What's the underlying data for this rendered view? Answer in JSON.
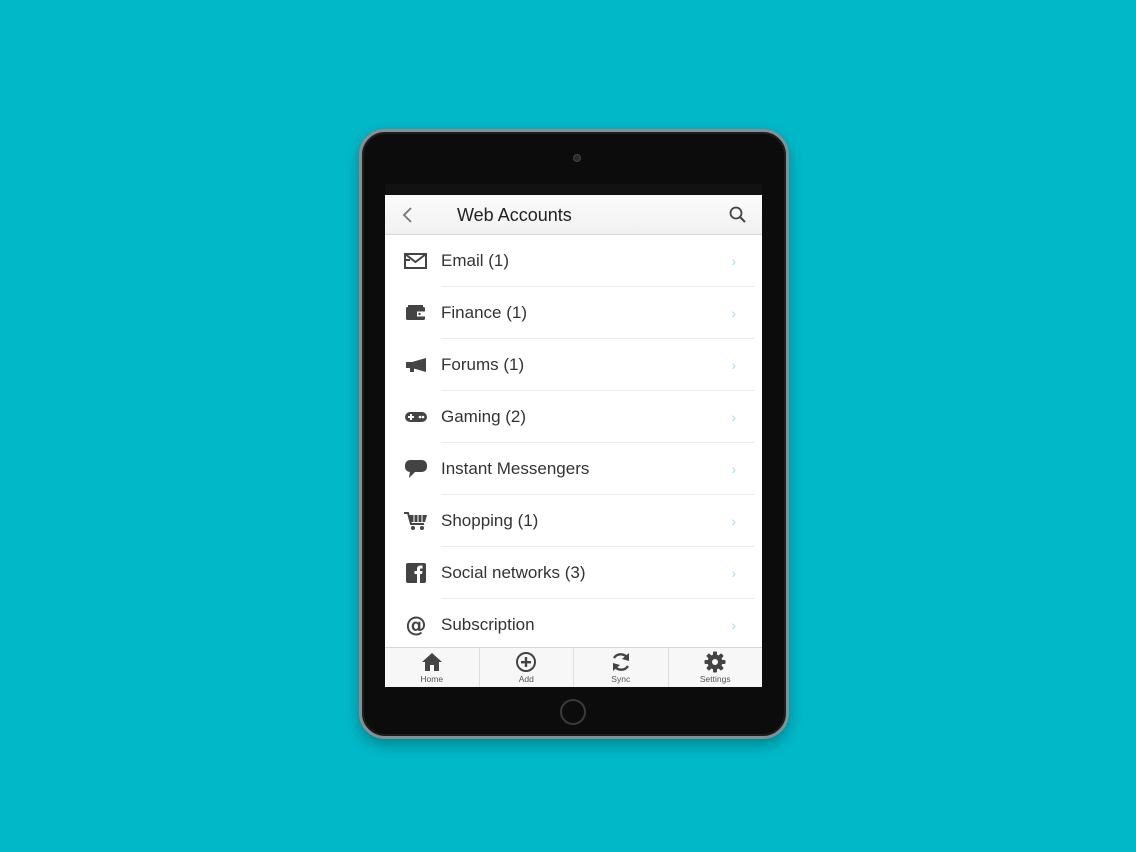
{
  "navbar": {
    "title": "Web Accounts",
    "back_icon": "chevron-left-icon",
    "search_icon": "search-icon"
  },
  "list": {
    "items": [
      {
        "label": "Email (1)",
        "icon": "envelope-icon"
      },
      {
        "label": "Finance (1)",
        "icon": "wallet-icon"
      },
      {
        "label": "Forums (1)",
        "icon": "megaphone-icon"
      },
      {
        "label": "Gaming (2)",
        "icon": "gamepad-icon"
      },
      {
        "label": "Instant Messengers",
        "icon": "chat-bubble-icon"
      },
      {
        "label": "Shopping (1)",
        "icon": "shopping-cart-icon"
      },
      {
        "label": "Social networks (3)",
        "icon": "facebook-icon"
      },
      {
        "label": "Subscription",
        "icon": "at-sign-icon"
      }
    ],
    "chevron": "›"
  },
  "tabbar": {
    "tabs": [
      {
        "label": "Home",
        "icon": "home-icon"
      },
      {
        "label": "Add",
        "icon": "plus-circle-icon"
      },
      {
        "label": "Sync",
        "icon": "sync-icon"
      },
      {
        "label": "Settings",
        "icon": "gear-icon"
      }
    ]
  },
  "colors": {
    "background": "#00b8c8",
    "chevron": "#9fe0ea",
    "icon": "#444444"
  }
}
